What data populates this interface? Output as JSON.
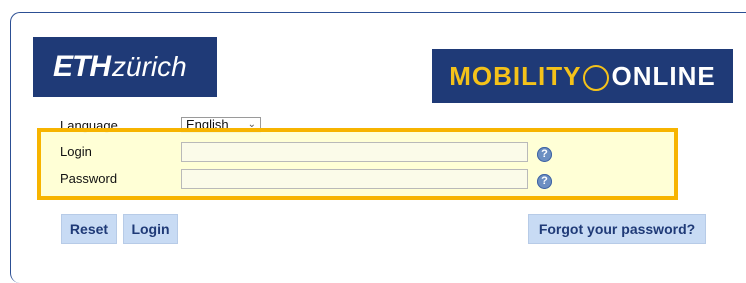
{
  "logos": {
    "eth_part1": "ETH",
    "eth_part2": "zürich",
    "mobility_part1": "MOBILITY",
    "mobility_part2": "ONLINE"
  },
  "form": {
    "language_label": "Language",
    "language_value": "English",
    "login_label": "Login",
    "password_label": "Password",
    "login_value": "",
    "password_value": "",
    "help_glyph": "?"
  },
  "buttons": {
    "reset": "Reset",
    "login": "Login",
    "forgot": "Forgot your password?"
  },
  "colors": {
    "brand_navy": "#1f3a77",
    "highlight": "#f7b400",
    "button_bg": "#c8dbf4"
  }
}
